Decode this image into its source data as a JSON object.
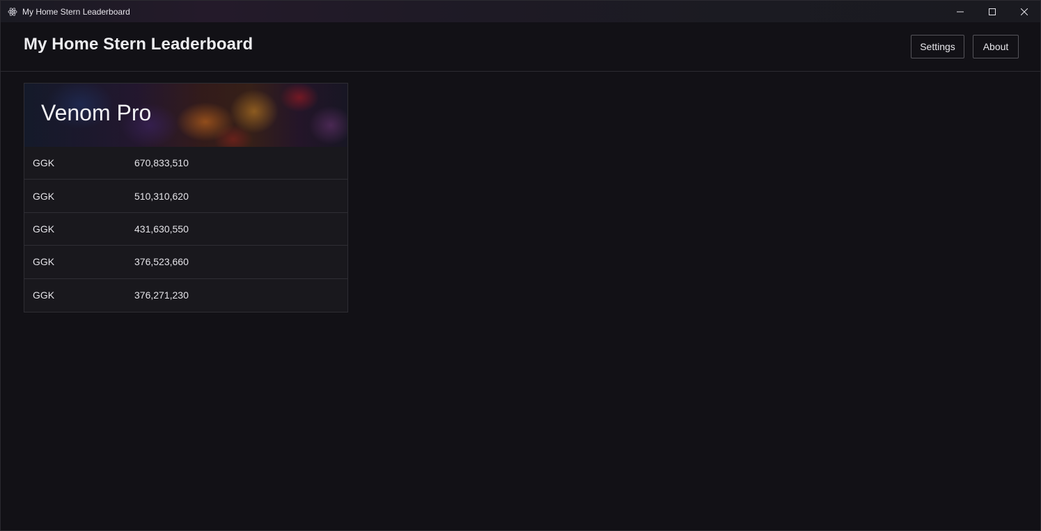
{
  "window": {
    "title": "My Home Stern Leaderboard",
    "icon": "electron-atom-icon"
  },
  "header": {
    "title": "My Home Stern Leaderboard",
    "buttons": {
      "settings": "Settings",
      "about": "About"
    }
  },
  "machines": [
    {
      "name": "Venom Pro",
      "scores": [
        {
          "initials": "GGK",
          "score": "670,833,510"
        },
        {
          "initials": "GGK",
          "score": "510,310,620"
        },
        {
          "initials": "GGK",
          "score": "431,630,550"
        },
        {
          "initials": "GGK",
          "score": "376,523,660"
        },
        {
          "initials": "GGK",
          "score": "376,271,230"
        }
      ]
    }
  ],
  "colors": {
    "background": "#121116",
    "card": "#19181d",
    "text": "#e8e6ea",
    "border": "#2f2e34"
  }
}
